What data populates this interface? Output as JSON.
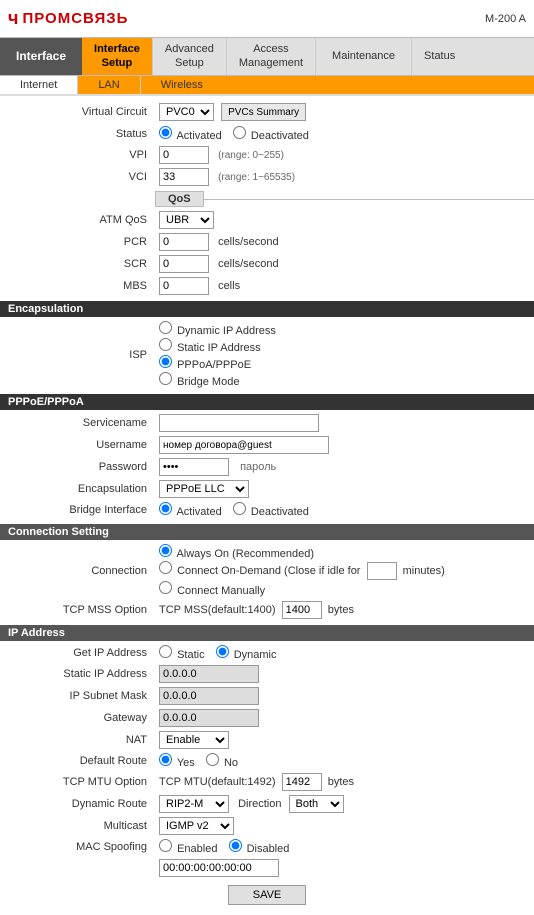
{
  "header": {
    "logo": "ПРОМСВЯЗЬ",
    "model": "M-200 A"
  },
  "nav": {
    "interface_label": "Interface",
    "tabs": [
      {
        "label": "Interface\nSetup",
        "active": true
      },
      {
        "label": "Advanced\nSetup",
        "active": false
      },
      {
        "label": "Access\nManagement",
        "active": false
      },
      {
        "label": "Maintenance",
        "active": false
      },
      {
        "label": "Status",
        "active": false
      }
    ]
  },
  "sub_tabs": [
    {
      "label": "Internet",
      "active": true
    },
    {
      "label": "LAN",
      "active": false
    },
    {
      "label": "Wireless",
      "active": false
    }
  ],
  "virtual_circuit": {
    "label": "Virtual Circuit",
    "value": "PVC0",
    "summary_button": "PVCs Summary"
  },
  "status": {
    "label": "Status",
    "activated": "Activated",
    "deactivated": "Deactivated",
    "selected": "activated"
  },
  "vpi": {
    "label": "VPI",
    "value": "0",
    "range": "(range: 0~255)"
  },
  "vci": {
    "label": "VCI",
    "value": "33",
    "range": "(range: 1~65535)"
  },
  "qos_section": "QoS",
  "atm_qos": {
    "label": "ATM QoS",
    "value": "UBR"
  },
  "pcr": {
    "label": "PCR",
    "value": "0",
    "unit": "cells/second"
  },
  "scr": {
    "label": "SCR",
    "value": "0",
    "unit": "cells/second"
  },
  "mbs": {
    "label": "MBS",
    "value": "0",
    "unit": "cells"
  },
  "encapsulation_section": "Encapsulation",
  "isp": {
    "label": "ISP",
    "options": [
      "Dynamic IP Address",
      "Static IP Address",
      "PPPoA/PPPoE",
      "Bridge Mode"
    ],
    "selected": "PPPoA/PPPoE"
  },
  "pppoe_section": "PPPoE/PPPoA",
  "servicename": {
    "label": "Servicename",
    "value": ""
  },
  "username": {
    "label": "Username",
    "value": "номер договора@guest"
  },
  "password": {
    "label": "Password",
    "value": "****",
    "hint": "пароль"
  },
  "encapsulation": {
    "label": "Encapsulation",
    "value": "PPPoE LLC"
  },
  "bridge_interface": {
    "label": "Bridge Interface",
    "activated": "Activated",
    "deactivated": "Deactivated",
    "selected": "activated"
  },
  "connection_setting_section": "Connection Setting",
  "connection": {
    "label": "Connection",
    "options": [
      "Always On (Recommended)",
      "Connect On-Demand (Close if idle for",
      "Connect Manually"
    ],
    "selected": "always_on",
    "idle_minutes": "",
    "minutes_label": "minutes)"
  },
  "tcp_mss": {
    "label": "TCP MSS Option",
    "prefix": "TCP MSS(default:1400)",
    "value": "1400",
    "unit": "bytes"
  },
  "ip_address_section": "IP Address",
  "get_ip": {
    "label": "Get IP Address",
    "static": "Static",
    "dynamic": "Dynamic",
    "selected": "dynamic"
  },
  "static_ip": {
    "label": "Static IP Address",
    "value": "0.0.0.0"
  },
  "subnet_mask": {
    "label": "IP Subnet Mask",
    "value": "0.0.0.0"
  },
  "gateway": {
    "label": "Gateway",
    "value": "0.0.0.0"
  },
  "nat": {
    "label": "NAT",
    "value": "Enable"
  },
  "default_route": {
    "label": "Default Route",
    "yes": "Yes",
    "no": "No",
    "selected": "yes"
  },
  "tcp_mtu": {
    "label": "TCP MTU Option",
    "prefix": "TCP MTU(default:1492)",
    "value": "1492",
    "unit": "bytes"
  },
  "dynamic_route": {
    "label": "Dynamic Route",
    "value": "RIP2-M",
    "direction_label": "Direction",
    "direction_value": "Both"
  },
  "multicast": {
    "label": "Multicast",
    "value": "IGMP v2"
  },
  "mac_spoofing": {
    "label": "MAC Spoofing",
    "enabled": "Enabled",
    "disabled": "Disabled",
    "selected": "disabled",
    "mac_value": "00:00:00:00:00:00"
  },
  "save_button": "SAVE"
}
